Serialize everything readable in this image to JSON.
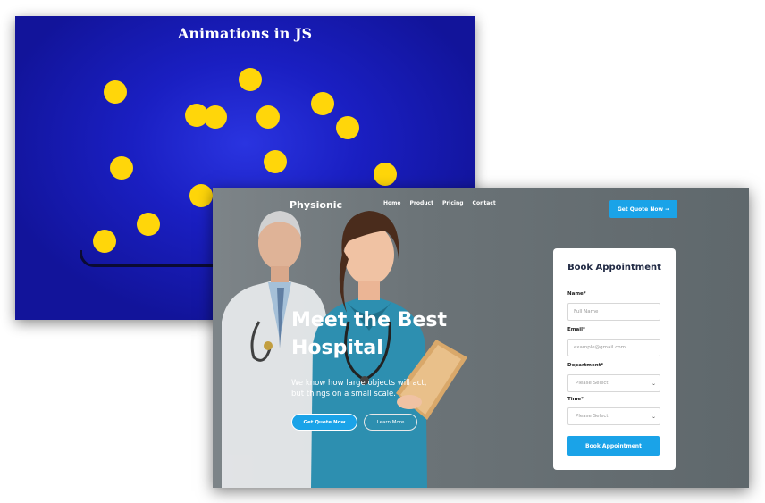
{
  "animation_demo": {
    "title": "Animations in JS",
    "ball_color": "#ffd60a",
    "background_color": "#1a1fc2"
  },
  "hospital_site": {
    "logo": "Physionic",
    "nav": [
      "Home",
      "Product",
      "Pricing",
      "Contact"
    ],
    "nav_cta": "Get Quote Now →",
    "hero": {
      "title_line1": "Meet the Best",
      "title_line2": "Hospital",
      "subtitle_line1": "We know how large objects will act,",
      "subtitle_line2": "but things on a small scale.",
      "primary_button": "Get Quote Now",
      "secondary_button": "Learn More"
    },
    "form": {
      "title": "Book Appointment",
      "name_label": "Name*",
      "name_placeholder": "Full Name",
      "email_label": "Email*",
      "email_placeholder": "example@gmail.com",
      "department_label": "Department*",
      "department_value": "Please Select",
      "time_label": "Time*",
      "time_value": "Please Select",
      "submit": "Book Appointment"
    },
    "accent_color": "#1aa3e8"
  }
}
